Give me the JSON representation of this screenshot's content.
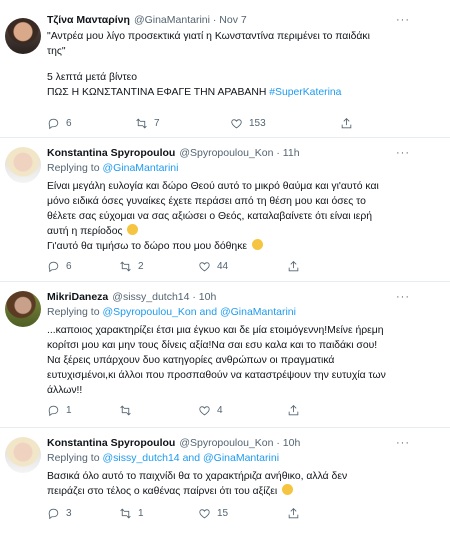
{
  "tweets": [
    {
      "name": "Τζίνα Μανταρίνη",
      "handle": "@GinaMantarini · Nov 7",
      "more": "···",
      "lines": [
        "\"Αντρέα μου λίγο προσεκτικά γιατί η Κωνσταντίνα περιμένει το παιδάκι",
        "της\""
      ],
      "lines2": [
        "5 λεπτά μετά βίντεο",
        "ΠΩΣ Η ΚΩΝΣΤΑΝΤΙΝΑ ΕΦΑΓΕ ΤΗΝ ΑΡΑΒΑΝΗ "
      ],
      "hashtag": "#SuperKaterina",
      "stats": {
        "replies": "6",
        "retweets": "7",
        "likes": "153"
      }
    },
    {
      "name": "Konstantina Spyropoulou",
      "handle": "@Spyropoulou_Kon · 11h",
      "more": "···",
      "reply_prefix": "Replying to ",
      "reply_to": "@GinaMantarini",
      "lines": [
        "Είναι μεγάλη ευλογία και δώρο Θεού αυτό το μικρό θαύμα και γι'αυτό και",
        "μόνο ειδικά όσες γυναίκες έχετε περάσει από τη θέση μου και όσες το",
        "θέλετε σας εύχομαι να σας αξιώσει ο Θεός, καταλαβαίνετε ότι είναι ιερή",
        "αυτή η περίοδος",
        "Γι'αυτό θα τιμήσω το δώρο που μου δόθηκε"
      ],
      "stats": {
        "replies": "6",
        "retweets": "2",
        "likes": "44"
      }
    },
    {
      "name": "MikriDaneza",
      "handle": "@sissy_dutch14 · 10h",
      "more": "···",
      "reply_prefix": "Replying to ",
      "reply_to": "@Spyropoulou_Kon and @GinaMantarini",
      "lines": [
        "...καποιος χαρακτηρίζει έτσι μια έγκυο και δε μία ετοιμόγεννη!Μείνε ήρεμη",
        "κορίτσι μου  και μην τους δίνεις αξία!Να σαι εσυ καλα και το παιδάκι σου!",
        "Να ξέρεις υπάρχουν δυο κατηγορίες ανθρώπων οι πραγματικά",
        "ευτυχισμένοι,κι άλλοι που προσπαθούν να καταστρέψουν την ευτυχία των",
        "άλλων!!"
      ],
      "stats": {
        "replies": "1",
        "retweets": "",
        "likes": "4"
      }
    },
    {
      "name": "Konstantina Spyropoulou",
      "handle": "@Spyropoulou_Kon · 10h",
      "more": "···",
      "reply_prefix": "Replying to ",
      "reply_to": "@sissy_dutch14 and @GinaMantarini",
      "lines": [
        "Βασικά όλο αυτό το παιχνίδι θα το χαρακτήριζα ανήθικο, αλλά δεν",
        "πειράζει στο τέλος ο καθένας παίρνει ότι του αξίζει"
      ],
      "stats": {
        "replies": "3",
        "retweets": "1",
        "likes": "15"
      }
    }
  ]
}
